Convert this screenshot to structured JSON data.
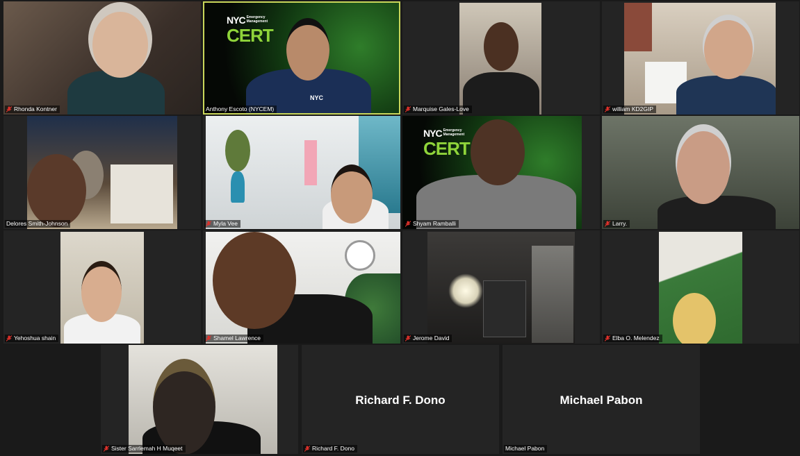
{
  "participants": [
    {
      "name": "Rhonda Kontner",
      "muted": true
    },
    {
      "name": "Anthony Escoto (NYCEM)",
      "muted": false,
      "active_speaker": true
    },
    {
      "name": "Marquise Gales-Love",
      "muted": true
    },
    {
      "name": "william KD2GIP",
      "muted": true
    },
    {
      "name": "Delores Smith-Johnson",
      "muted": false
    },
    {
      "name": "Myla Vee",
      "muted": true
    },
    {
      "name": "Shyam Ramballi",
      "muted": true
    },
    {
      "name": "Larry.",
      "muted": true
    },
    {
      "name": "Yehoshua shain",
      "muted": true
    },
    {
      "name": "Shamel Lawrence",
      "muted": true
    },
    {
      "name": "Jerome David",
      "muted": true
    },
    {
      "name": "Elba O. Melendez",
      "muted": true
    },
    {
      "name": "Sister Sarrlemah H Muqeet",
      "muted": true
    },
    {
      "name": "Richard F. Dono",
      "muted": true,
      "video_off": true,
      "display_label": "Richard F. Dono"
    },
    {
      "name": "Michael Pabon",
      "muted": false,
      "video_off": true,
      "display_label": "Michael Pabon"
    }
  ],
  "logos": {
    "nyc": "NYC",
    "emergency_management": "Emergency Management",
    "cert": "CERT",
    "shirt_logo": "NYC"
  },
  "colors": {
    "background": "#1a1a1a",
    "tile": "#242424",
    "active_speaker_border": "#c9d65a",
    "muted_icon": "#e0312b",
    "cert_green": "#8fd43a"
  }
}
